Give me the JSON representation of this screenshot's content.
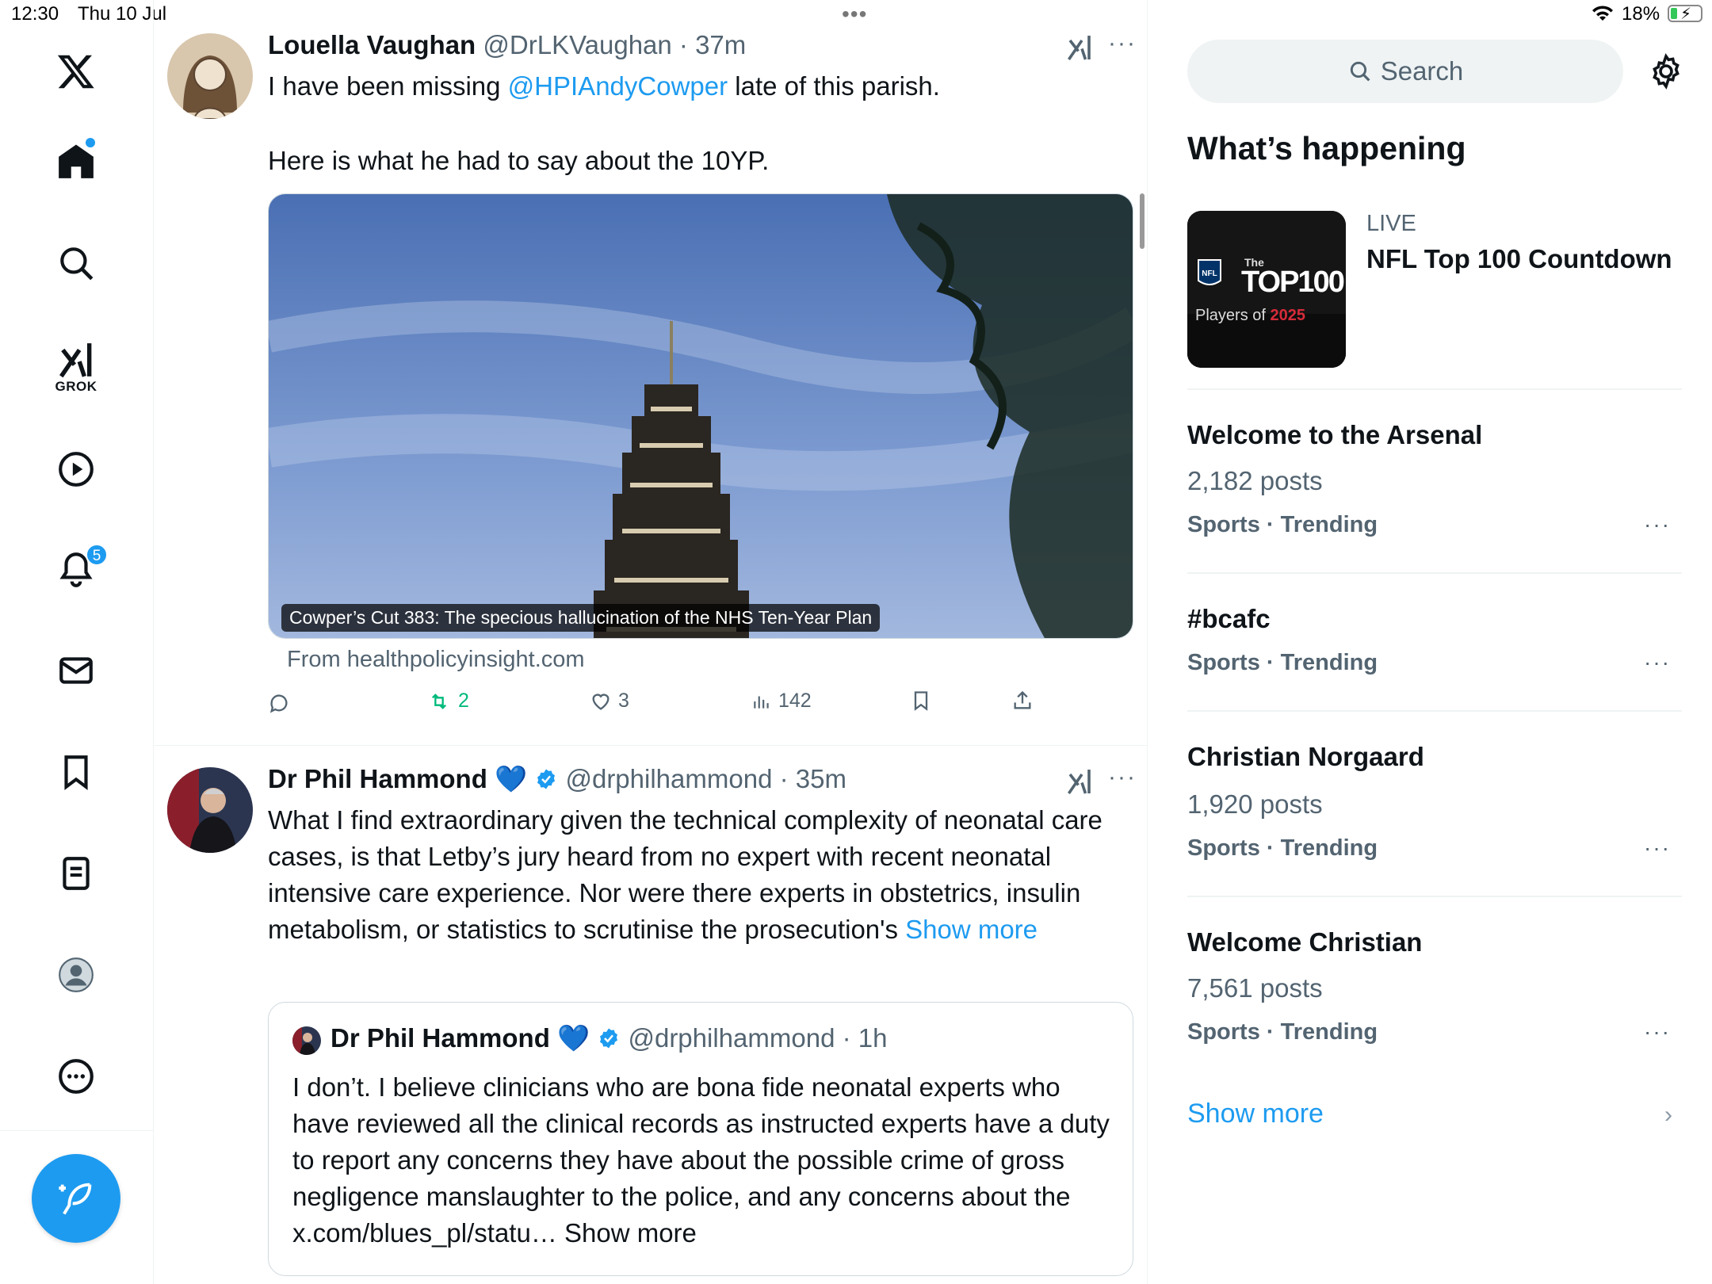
{
  "status_bar": {
    "time": "12:30",
    "date": "Thu 10 Jul",
    "battery": "18%"
  },
  "nav": {
    "grok_label": "GROK",
    "notifications_badge": "5"
  },
  "tweets": [
    {
      "name": "Louella Vaughan",
      "handle_time": "@DrLKVaughan · 37m",
      "text_line1_before": "I have been missing ",
      "mention": "@HPIAndyCowper",
      "text_line1_after": " late of this parish.",
      "text_line2": "Here is what he had to say about the 10YP.",
      "media_caption": "Cowper’s Cut 383: The specious hallucination of the NHS Ten-Year Plan",
      "from": "From healthpolicyinsight.com",
      "actions": {
        "reposts": "2",
        "likes": "3",
        "views": "142"
      }
    },
    {
      "name": "Dr Phil Hammond",
      "heart": "💙",
      "handle_time": "@drphilhammond · 35m",
      "text": "What I find extraordinary given the technical complexity of neonatal care cases, is that Letby’s jury heard from no expert with recent neonatal intensive care experience. Nor were there experts in obstetrics, insulin metabolism, or statistics to scrutinise the prosecution's",
      "show_more": "Show more",
      "quote": {
        "name": "Dr Phil Hammond",
        "heart": "💙",
        "handle_time": "@drphilhammond · 1h",
        "text": "I don’t. I believe clinicians who are bona fide neonatal experts who have reviewed all the clinical records as instructed experts have a duty to report any concerns they have about the possible  crime of gross negligence manslaughter to the police, and any concerns about the x.com/blues_pl/statu… Show more"
      }
    }
  ],
  "right": {
    "search_placeholder": "Search",
    "whats_happening": "What’s happening",
    "live": {
      "label": "LIVE",
      "title": "NFL Top 100 Countdown",
      "thumb_the": "The",
      "thumb_top": "TOP100",
      "thumb_players": "Players of ",
      "thumb_year": "2025",
      "thumb_nfl": "NFL"
    },
    "trends": [
      {
        "title": "Welcome to the Arsenal",
        "count": "2,182 posts",
        "category": "Sports · Trending"
      },
      {
        "title": "#bcafc",
        "count": "",
        "category": "Sports · Trending"
      },
      {
        "title": "Christian Norgaard",
        "count": "1,920 posts",
        "category": "Sports · Trending"
      },
      {
        "title": "Welcome Christian",
        "count": "7,561 posts",
        "category": "Sports · Trending"
      }
    ],
    "show_more": "Show more"
  },
  "colors": {
    "accent": "#1d9bf0",
    "repost": "#00ba7c",
    "muted": "#536471"
  }
}
